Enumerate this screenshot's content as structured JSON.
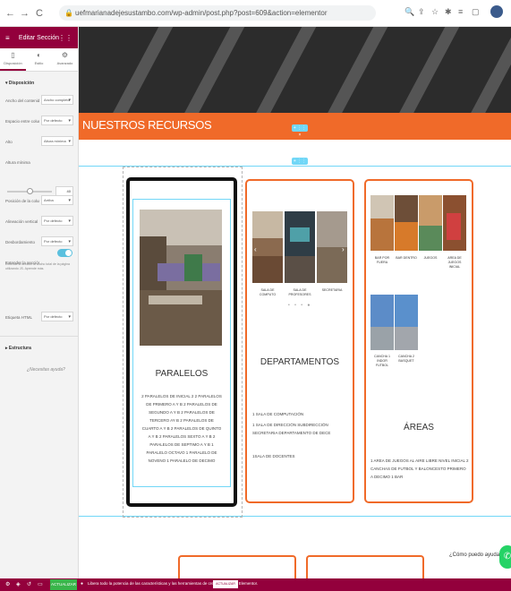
{
  "browser": {
    "url": "uefmarianadejesustambo.com/wp-admin/post.php?post=609&action=elementor",
    "back": "←",
    "forward": "→",
    "reload": "C"
  },
  "sidebar": {
    "title": "Editar Sección",
    "tabs": [
      {
        "label": "Disposición",
        "icon": "layout-icon"
      },
      {
        "label": "Estilo",
        "icon": "style-icon"
      },
      {
        "label": "Avanzado",
        "icon": "gear-icon"
      }
    ],
    "section_layout": "▾ Disposición",
    "rows": [
      {
        "label": "Ancho del contenido",
        "value": "Ancho completo"
      },
      {
        "label": "Espacio entre columnas",
        "value": "Por defecto"
      },
      {
        "label": "Alto",
        "value": "Altura mínima"
      },
      {
        "label": "Altura mínima",
        "value": ""
      },
      {
        "label": "Posición de la columna",
        "value": "Arriba"
      },
      {
        "label": "Alineación vertical",
        "value": "Por defecto"
      },
      {
        "label": "Desbordamiento",
        "value": "Por defecto"
      },
      {
        "label": "Extender la sección",
        "value": ""
      },
      {
        "label": "Etiqueta HTML",
        "value": "Por defecto"
      }
    ],
    "slider_value": "40",
    "stretch_note": "Extiende la sección al ancho total de la página utilizando JS. Aprende más.",
    "section_structure": "▸ Estructura",
    "need_help": "¿Necesitas ayuda?"
  },
  "bottombar": {
    "update": "ACTUALIZAR",
    "promo": "Libera todo la potencia de las características y las herramientas de creación web de Elementor.",
    "promo_button": "ACTUALIZAR AHORA"
  },
  "banner": {
    "title": "NUESTROS RECURSOS"
  },
  "cards": {
    "paralelos": {
      "title": "PARALELOS",
      "text": "2 PARALELOS DE INICIAL 2 2 PARALELOS DE PRIMERO A Y B 2 PARALELOS DE SEGUNDO A Y B 2 PARALELOS DE TERCERO AY B 2 PARALELOS DE CUARTO A Y B 2 PARALELOS DE QUINTO A Y B 2 PARALELOS SEXTO A Y B 2 PARALELOS DE SEPTIMO A Y B 1 PARALELO OCTAVO 1 PARALELO DE NOVENO 1 PARALELO DE DECIMO"
    },
    "departamentos": {
      "title": "DEPARTAMENTOS",
      "photo_labels": [
        "SALA DE COMPUTO",
        "SALA DE PROFESORES",
        "SECRETARIA"
      ],
      "dots": "• • • ●",
      "text1": "1 SALA DE COMPUTACIÓN",
      "text2": "1 SALA DE DIRECCIÓN SUBDIRECCIÓN SECRETARIA DEPARTAMENTO DE DECE",
      "text3": "1SALA DE DOCENTES"
    },
    "areas": {
      "title": "ÁREAS",
      "photo_labels": [
        "BAR POR FUERA",
        "BAR DENTRO",
        "JUEGOS",
        "AREA DE JUEGOS INICIAL",
        "CANCHA 1 INDOR FUTBOL",
        "CANCHA 2 BASQUET"
      ],
      "text": "1 AREA DE JUEGOS AL AIRE LIBRE NIVEL INICIAL 2 CANCHAS DE FUTBOL Y BALONCESTO PRIMERO A DECIMO 1 BAR"
    }
  },
  "chat": {
    "label": "¿Cómo puedo ayudarte?"
  }
}
